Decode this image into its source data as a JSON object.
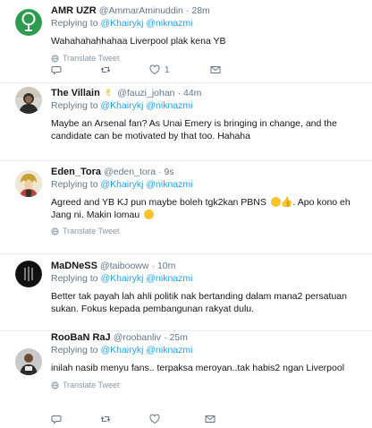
{
  "tweets": [
    {
      "name": "AMR UZR",
      "handle": "@AmmarAminuddin",
      "time": "· 28m",
      "replying_prefix": "Replying to ",
      "mention1": "@Khairykj",
      "mention2": "@niknazmi",
      "text": "Wahahahahhahaa Liverpool plak kena YB",
      "translate": "Translate Tweet",
      "like_count": "1",
      "avatar": "green-tree-icon"
    },
    {
      "name": "The Villain",
      "name_emoji": "✌",
      "handle": "@fauzi_johan",
      "time": "· 44m",
      "replying_prefix": "Replying to ",
      "mention1": "@Khairykj",
      "mention2": "@niknazmi",
      "text": "Maybe an Arsenal fan? As Unai Emery is bringing in change, and the candidate can be motivated by that too. Hahaha",
      "avatar": "person-photo"
    },
    {
      "name": "Eden_Tora",
      "handle": "@eden_tora",
      "time": "· 9s",
      "replying_prefix": "Replying to ",
      "mention1": "@Khairykj",
      "mention2": "@niknazmi",
      "text": "Agreed and YB KJ pun maybe boleh tgk2kan PBNS",
      "text_tail": ". Apo kono eh Jang ni. Makin lomau",
      "translate": "Translate Tweet",
      "avatar": "anime-character"
    },
    {
      "name": "MaDNeSS",
      "handle": "@taibooww",
      "time": "· 10m",
      "replying_prefix": "Replying to ",
      "mention1": "@Khairykj",
      "mention2": "@niknazmi",
      "text": "Better tak payah lah ahli politik nak bertanding dalam mana2 persatuan sukan. Fokus kepada pembangunan rakyat dulu.",
      "avatar": "dark-logo"
    },
    {
      "name": "RooBaN RaJ",
      "handle": "@roobanliv",
      "time": "· 25m",
      "replying_prefix": "Replying to ",
      "mention1": "@Khairykj",
      "mention2": "@niknazmi",
      "text": "inilah nasib menyu fans.. terpaksa meroyan..tak habis2 ngan Liverpool",
      "translate": "Translate Tweet",
      "avatar": "person-photo"
    }
  ],
  "colors": {
    "link": "#1da1f2",
    "muted": "#657786",
    "border": "#e6ecf0"
  }
}
